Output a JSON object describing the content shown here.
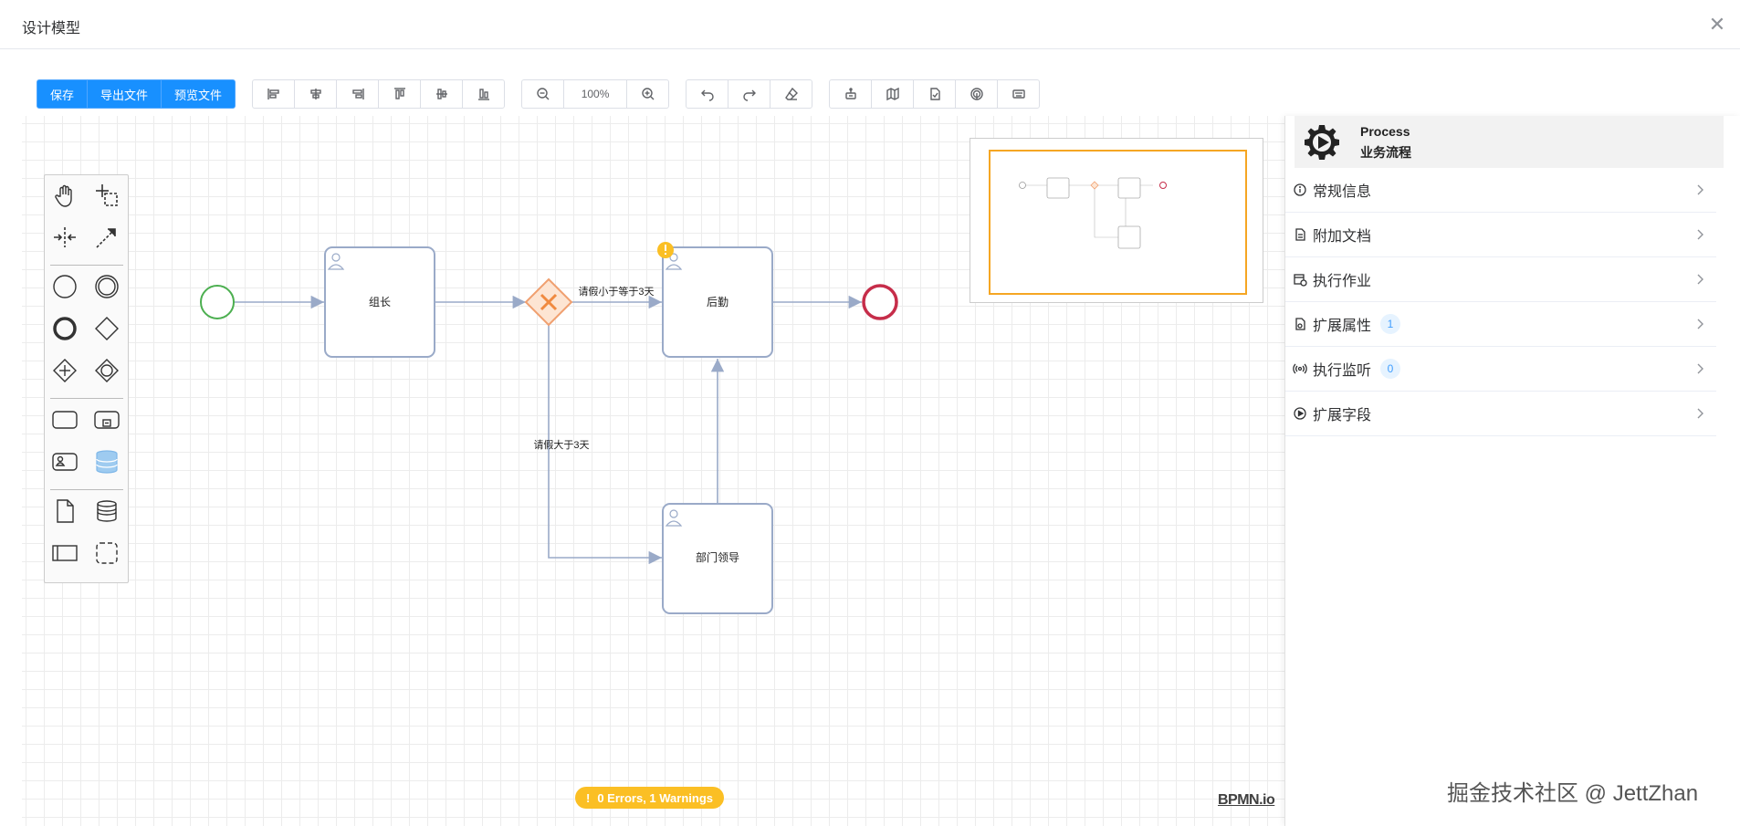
{
  "dialog": {
    "title": "设计模型",
    "close_icon": "close-icon"
  },
  "toolbar": {
    "save_label": "保存",
    "export_label": "导出文件",
    "preview_label": "预览文件",
    "zoom_level": "100%",
    "accent_color": "#1890ff"
  },
  "diagram": {
    "task_leader": "组长",
    "task_approve": "后勤",
    "task_dept": "部门领导",
    "flow_le_3": "请假小于等于3天",
    "flow_gt_3": "请假大于3天"
  },
  "status": {
    "text": "0 Errors, 1 Warnings",
    "color": "#fbbf24"
  },
  "logo": "BPMN.io",
  "panel": {
    "type": "Process",
    "name": "业务流程",
    "sections": [
      {
        "label": "常规信息",
        "icon": "info-icon"
      },
      {
        "label": "附加文档",
        "icon": "document-icon"
      },
      {
        "label": "执行作业",
        "icon": "calendar-clock-icon"
      },
      {
        "label": "扩展属性",
        "icon": "extension-icon",
        "badge": "1"
      },
      {
        "label": "执行监听",
        "icon": "signal-icon",
        "badge": "0"
      },
      {
        "label": "扩展字段",
        "icon": "play-circle-icon"
      }
    ]
  },
  "watermark": "掘金技术社区 @ JettZhan"
}
